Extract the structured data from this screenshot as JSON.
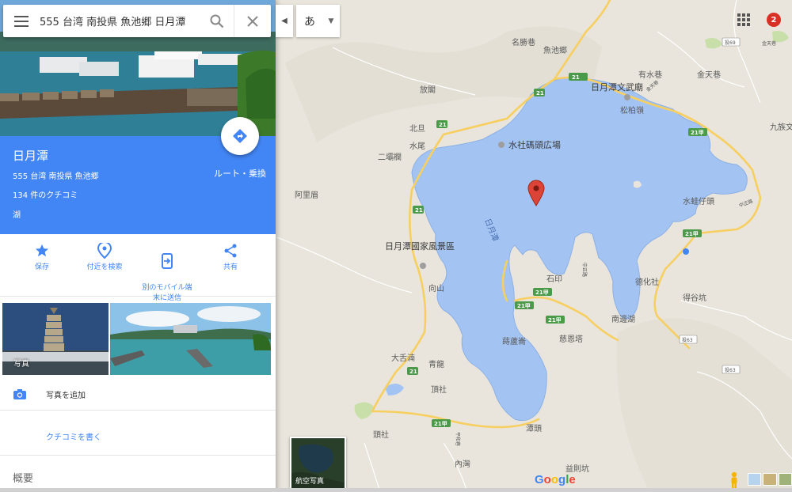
{
  "search": {
    "query": "555 台湾 南投県 魚池郷 日月潭",
    "ime_label": "あ"
  },
  "place": {
    "name": "日月潭",
    "address": "555 台湾 南投県 魚池郷",
    "reviews": "134 件のクチコミ",
    "type": "湖",
    "route_label": "ルート・乗換"
  },
  "actions": [
    {
      "label": "保存",
      "icon": "star-icon"
    },
    {
      "label": "付近を検索",
      "icon": "nearby-pin-icon"
    },
    {
      "label": "別のモバイル端\n末に送信",
      "icon": "send-to-device-icon"
    },
    {
      "label": "共有",
      "icon": "share-icon"
    }
  ],
  "photos": {
    "label": "写真"
  },
  "add_photo_label": "写真を追加",
  "write_review_label": "クチコミを書く",
  "overview_label": "概要",
  "notifications": {
    "count": "2"
  },
  "satellite_toggle_label": "航空写真",
  "google_logo": "Google",
  "colors": {
    "accent": "#4285f4",
    "water": "#a3c4f3",
    "land": "#e9e5dc",
    "road": "#f7cf61",
    "marker": "#db4437"
  },
  "map": {
    "lake_labels": {
      "vertical": "日月潭"
    },
    "places": [
      "名勝巷",
      "魚池郷",
      "有水巷",
      "金天巷",
      "日月潭文武廟",
      "放閣",
      "松柏嶺",
      "北旦",
      "水尾",
      "二壩欄",
      "水社碼頭広場",
      "九族文",
      "阿里眉",
      "水蛙仔頭",
      "日月潭國家風景區",
      "向山",
      "石印",
      "德化社",
      "得谷坑",
      "南邊湖",
      "蒔蘆崙",
      "慈恩塔",
      "大舌湳",
      "青龍",
      "頂社",
      "頭社",
      "潭頭",
      "內灣",
      "益則坑",
      "中正路",
      "中正路",
      "平和巷",
      "金天巷"
    ],
    "roads": [
      "21",
      "21",
      "21",
      "21",
      "21甲",
      "21甲",
      "21甲",
      "21甲",
      "21甲",
      "21甲",
      "21"
    ],
    "county_roads": [
      "投69",
      "投63",
      "投63"
    ],
    "gold_label": "金天巷"
  }
}
